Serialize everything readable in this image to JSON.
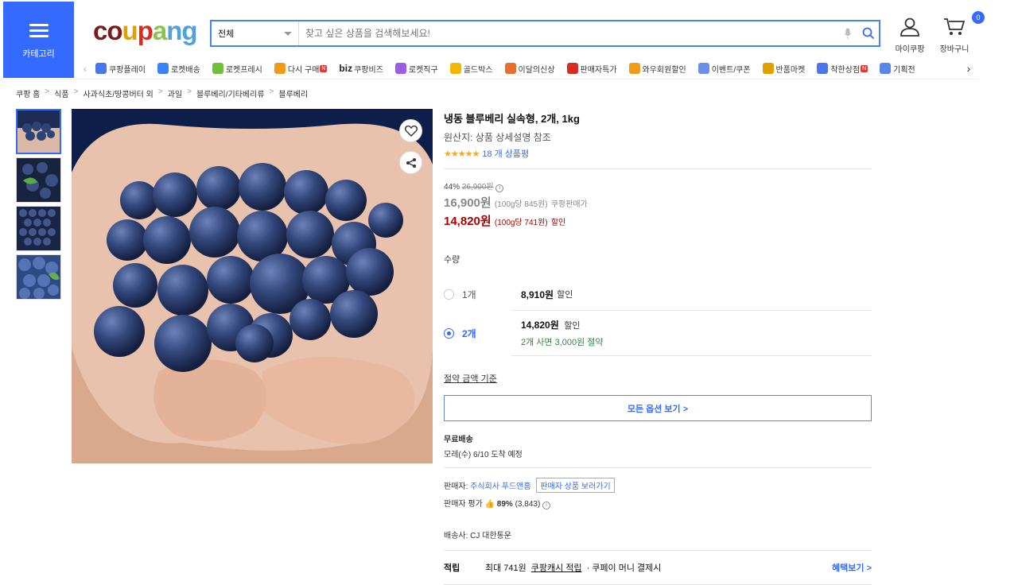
{
  "header": {
    "category_label": "카테고리",
    "logo": [
      "c",
      "o",
      "u",
      "p",
      "a",
      "n",
      "g"
    ],
    "logo_colors": [
      "#7a1c1c",
      "#7a1c1c",
      "#e0a100",
      "#d62d20",
      "#8bc34a",
      "#4fa3d9",
      "#4fa3d9"
    ],
    "search_scope": "전체",
    "search_placeholder": "찾고 싶은 상품을 검색해보세요!",
    "mycoupang_label": "마이쿠팡",
    "cart_label": "장바구니",
    "cart_count": "0"
  },
  "nav": {
    "items": [
      {
        "label": "쿠팡플레이",
        "icon": "play-icon",
        "color": "#4a76e8"
      },
      {
        "label": "로켓배송",
        "icon": "rocket-icon",
        "color": "#3b82f6"
      },
      {
        "label": "로켓프레시",
        "icon": "rocket-fresh-icon",
        "color": "#6fbf3a"
      },
      {
        "label": "다시 구매",
        "icon": "cart-repeat-icon",
        "color": "#f29a1a",
        "new": "N"
      },
      {
        "label": "쿠팡비즈",
        "icon": "biz-icon",
        "color": "#222",
        "prefix": "biz"
      },
      {
        "label": "로켓직구",
        "icon": "globe-icon",
        "color": "#9b5de5"
      },
      {
        "label": "골드박스",
        "icon": "gold-box-icon",
        "color": "#f2b705"
      },
      {
        "label": "이달의신상",
        "icon": "bag-icon",
        "color": "#e76f2c"
      },
      {
        "label": "판매자특가",
        "icon": "percent-icon",
        "color": "#d62d20"
      },
      {
        "label": "와우회원할인",
        "icon": "wow-icon",
        "color": "#f29a1a"
      },
      {
        "label": "이벤트/쿠폰",
        "icon": "coupon-icon",
        "color": "#6c8ee6"
      },
      {
        "label": "반품마켓",
        "icon": "return-market-icon",
        "color": "#e0a100"
      },
      {
        "label": "착한상점",
        "icon": "good-store-icon",
        "color": "#4a76e8",
        "new": "N"
      },
      {
        "label": "기획전",
        "icon": "tag-icon",
        "color": "#5a86e8"
      }
    ]
  },
  "breadcrumb": [
    "쿠팡 홈",
    "식품",
    "사과식초/땅콩버터 외",
    "과일",
    "블루베리/기타베리류",
    "블루베리"
  ],
  "product": {
    "title": "냉동 블루베리 실속형, 2개, 1kg",
    "origin": "원산지: 상품 상세설명 참조",
    "stars": "★★★★★",
    "review_count": "18 개 상품평",
    "discount_rate": "44%",
    "original_price": "26,900원",
    "coupang_price": "16,900원",
    "coupang_unit": "(100g당 845원)",
    "coupang_label": "쿠팡판매가",
    "sale_price": "14,820원",
    "sale_unit": "(100g당 741원)",
    "sale_label": "할인"
  },
  "quantity": {
    "label": "수량",
    "options": [
      {
        "name": "1개",
        "price": "8,910원",
        "tag": "할인",
        "note": "",
        "selected": false
      },
      {
        "name": "2개",
        "price": "14,820원",
        "tag": "할인",
        "note": "2개 사면 3,000원 절약",
        "selected": true
      }
    ],
    "savings_link": "절약 금액 기준",
    "all_options": "모든 옵션 보기 >"
  },
  "shipping": {
    "free_label": "무료배송",
    "arrival": "모레(수) 6/10 도착 예정"
  },
  "seller": {
    "label": "판매자:",
    "name": "주식회사 푸드앤홈",
    "products_button": "판매자 상품 보러가기",
    "rating_label": "판매자 평가",
    "rating_value": "89%",
    "rating_count": "(3,843)",
    "carrier_label": "배송사:",
    "carrier": "CJ 대한통운"
  },
  "points": {
    "label": "적립",
    "max": "최대 741원",
    "cash_link": "쿠팡캐시 적립",
    "condition": "· 쿠페이 머니 결제시",
    "benefit_link": "혜택보기 >"
  }
}
